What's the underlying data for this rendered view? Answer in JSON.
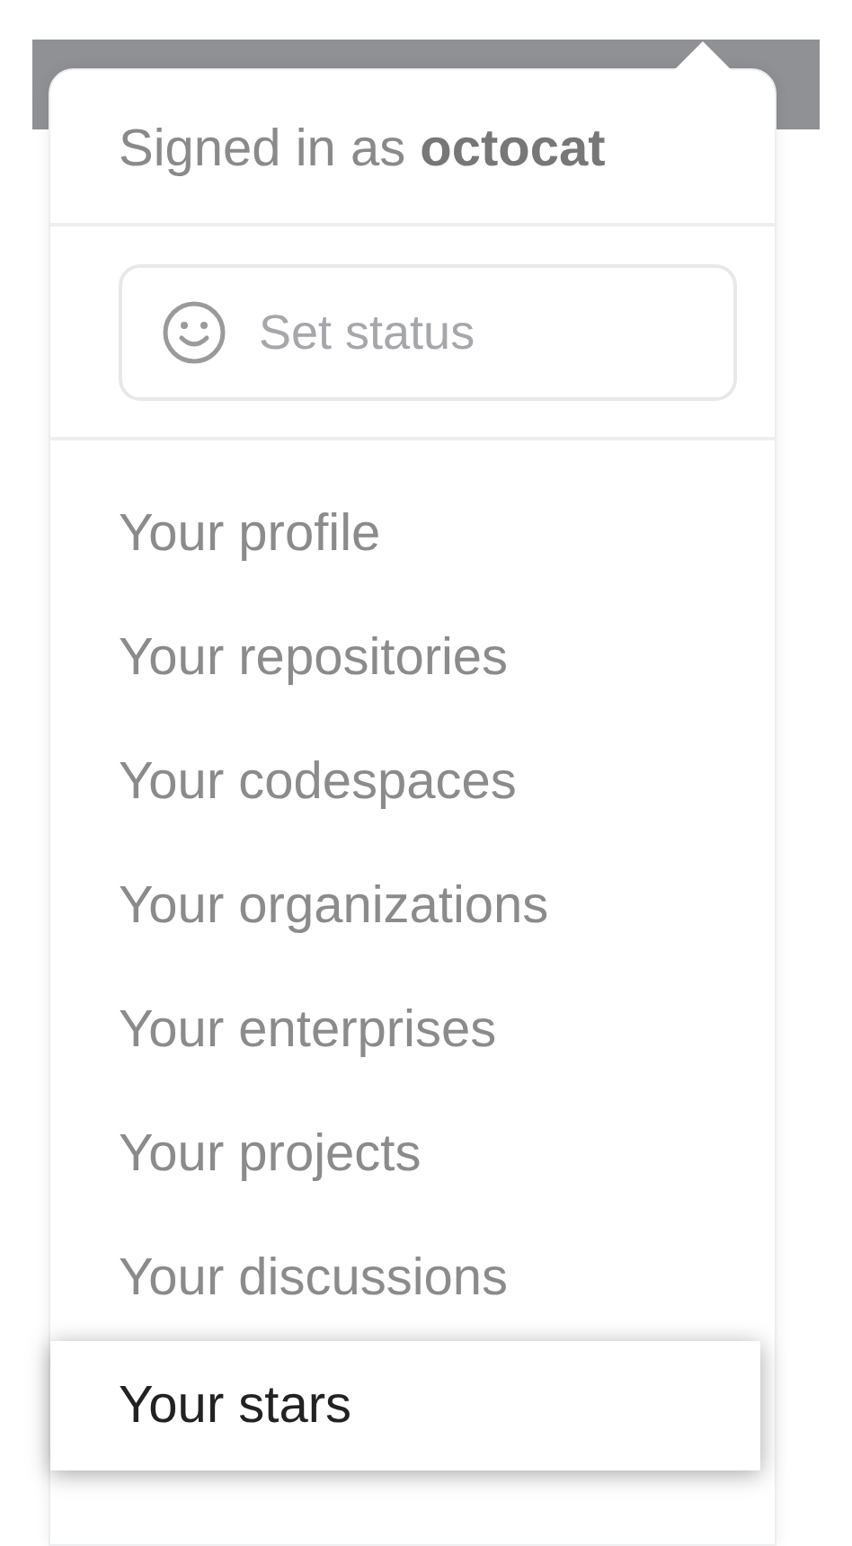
{
  "header": {
    "text": "Signed in as **octocat**"
  },
  "status_button": {
    "label": "Set status"
  },
  "menu_items": [
    {
      "label": "Your profile",
      "selected": false
    },
    {
      "label": "Your repositories",
      "selected": false
    },
    {
      "label": "Your codespaces",
      "selected": false
    },
    {
      "label": "Your organizations",
      "selected": false
    },
    {
      "label": "Your enterprises",
      "selected": false
    },
    {
      "label": "Your projects",
      "selected": false
    },
    {
      "label": "Your discussions",
      "selected": false
    },
    {
      "label": "Your stars",
      "selected": true
    }
  ]
}
